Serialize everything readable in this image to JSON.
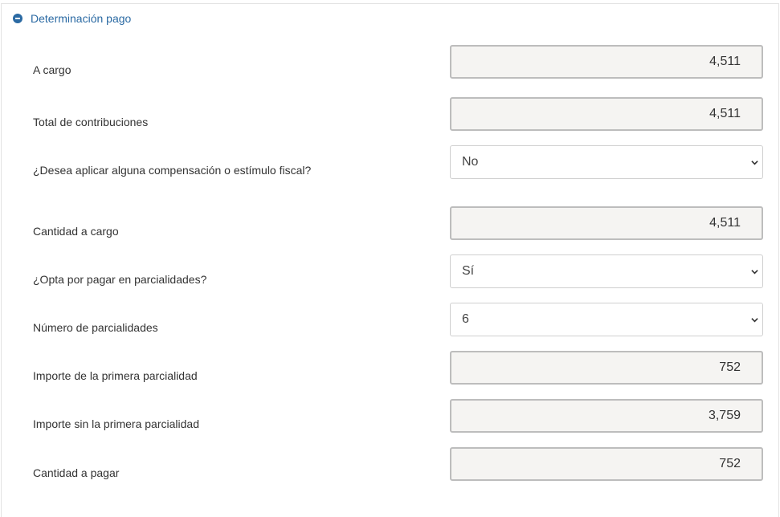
{
  "section": {
    "title": "Determinación pago",
    "toggle_icon": "minus-circle-icon",
    "accent_color": "#2b6aa3"
  },
  "rows": [
    {
      "label": "A cargo",
      "type": "readonly",
      "value": "4,511"
    },
    {
      "label": "Total de contribuciones",
      "type": "readonly",
      "value": "4,511"
    },
    {
      "label": "¿Desea aplicar alguna compensación o estímulo fiscal?",
      "type": "select",
      "value": "No"
    },
    {
      "label": "Cantidad a cargo",
      "type": "readonly",
      "value": "4,511"
    },
    {
      "label": "¿Opta por pagar en parcialidades?",
      "type": "select",
      "value": "Sí"
    },
    {
      "label": "Número de parcialidades",
      "type": "select",
      "value": "6"
    },
    {
      "label": "Importe de la primera parcialidad",
      "type": "readonly",
      "value": "752"
    },
    {
      "label": "Importe sin la primera parcialidad",
      "type": "readonly",
      "value": "3,759"
    },
    {
      "label": "Cantidad a pagar",
      "type": "readonly",
      "value": "752"
    }
  ]
}
